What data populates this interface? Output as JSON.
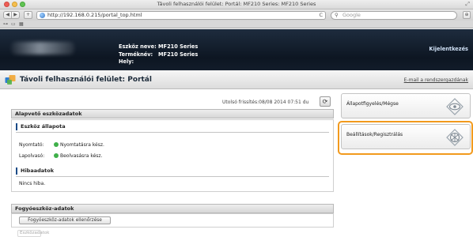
{
  "browser": {
    "window_title": "Távoli felhasználói felület: Portál: MF210 Series: MF210 Series",
    "url": "http://192.168.0.215/portal_top.html",
    "search_placeholder": "Google",
    "reload_glyph": "C",
    "back_glyph": "◀",
    "forward_glyph": "▶",
    "new_tab_glyph": "+"
  },
  "device": {
    "name_label": "Eszköz neve:",
    "name_value": "MF210 Series",
    "product_label": "Terméknév:",
    "product_value": "MF210 Series",
    "location_label": "Hely:",
    "location_value": "",
    "logout": "Kijelentkezés"
  },
  "portal": {
    "title": "Távoli felhasználói felület: Portál",
    "mail_link": "E-mail a rendszergazdának"
  },
  "status": {
    "last_updated": "Utolsó frissítés:08/08 2014 07:51 du",
    "basic_info_header": "Alapvető eszközadatok",
    "device_status_header": "Eszköz állapota",
    "printer_label": "Nyomtató:",
    "printer_value": "Nyomtatásra kész.",
    "scanner_label": "Lapolvasó:",
    "scanner_value": "Beolvasásra kész.",
    "error_header": "Hibaadatok",
    "error_value": "Nincs hiba.",
    "consumables_header": "Fogyóeszköz-adatok",
    "consumables_button": "Fogyóeszköz-adatok ellenőrzése",
    "truncated_button": "Eszközadatok"
  },
  "side_menu": [
    {
      "label": "Állapotfigyelés/Mégse",
      "icon": "eye-icon"
    },
    {
      "label": "Beállítások/Regisztrálás",
      "icon": "settings-icon",
      "highlighted": true
    }
  ],
  "colors": {
    "header_dark": "#0d1622",
    "highlight_orange": "#f29a1d",
    "status_ok_green": "#3fb04a"
  }
}
